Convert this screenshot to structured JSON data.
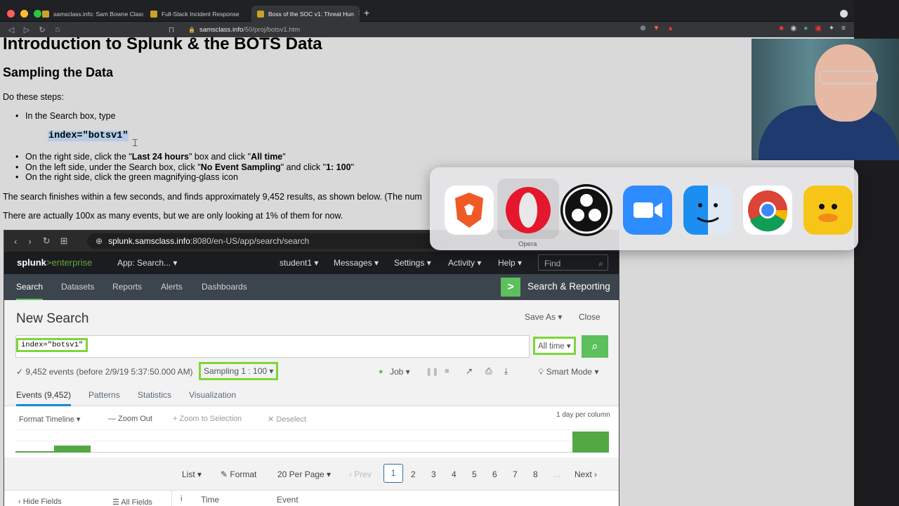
{
  "browser": {
    "tabs": [
      {
        "label": "samsclass.info: Sam Bowne Class In"
      },
      {
        "label": "Full-Stack Incident Response"
      },
      {
        "label": "Boss of the SOC v1: Threat Hun"
      }
    ],
    "url_host": "samsclass.info",
    "url_path": "/50/proj/botsv1.htm"
  },
  "page": {
    "h1": "Introduction to Splunk & the BOTS Data",
    "h2": "Sampling the Data",
    "intro": "Do these steps:",
    "step1": "In the Search box, type",
    "code": "index=\"botsv1\"",
    "step2_a": "On the right side, click the \"",
    "step2_b": "Last 24 hours",
    "step2_c": "\" box and click \"",
    "step2_d": "All time",
    "step2_e": "\"",
    "step3_a": "On the left side, under the Search box, click \"",
    "step3_b": "No Event Sampling",
    "step3_c": "\" and click \"",
    "step3_d": "1: 100",
    "step3_e": "\"",
    "step4": "On the right side, click the green magnifying-glass icon",
    "para1": "The search finishes within a few seconds, and finds approximately 9,452 results, as shown below. (The num",
    "para2": "There are actually 100x as many events, but we are only looking at 1% of them for now."
  },
  "splunk": {
    "url_host": "splunk.samsclass.info",
    "url_rest": ":8080/en-US/app/search/search",
    "logo_a": "splunk",
    "logo_b": ">enterprise",
    "app": "App: Search... ▾",
    "user": "student1 ▾",
    "messages": "Messages ▾",
    "settings": "Settings ▾",
    "activity": "Activity ▾",
    "help": "Help ▾",
    "find": "Find",
    "nav": [
      "Search",
      "Datasets",
      "Reports",
      "Alerts",
      "Dashboards"
    ],
    "app_title": "Search & Reporting",
    "new_search": "New Search",
    "save_as": "Save As ▾",
    "close": "Close",
    "query": "index=\"botsv1\"",
    "time_range": "All time ▾",
    "events_status": "✓ 9,452 events (before 2/9/19 5:37:50.000 AM)",
    "sampling": "Sampling 1 : 100 ▾",
    "job": "Job ▾",
    "mode": "Smart Mode ▾",
    "tabs": [
      "Events (9,452)",
      "Patterns",
      "Statistics",
      "Visualization"
    ],
    "format_timeline": "Format Timeline ▾",
    "zoom_out": "— Zoom Out",
    "zoom_sel": "+ Zoom to Selection",
    "deselect": "✕ Deselect",
    "per_col": "1 day per column",
    "list": "List ▾",
    "format": "✎ Format",
    "per_page": "20 Per Page ▾",
    "prev": "‹ Prev",
    "pages": [
      "1",
      "2",
      "3",
      "4",
      "5",
      "6",
      "7",
      "8",
      "..."
    ],
    "next": "Next ›",
    "hide_fields": "‹ Hide Fields",
    "all_fields": "☰ All Fields",
    "col_i": "i",
    "col_time": "Time",
    "col_event": "Event"
  },
  "dock": {
    "hover_label": "Opera",
    "apps": [
      "brave-icon",
      "opera-icon",
      "obs-icon",
      "zoom-icon",
      "finder-icon",
      "chrome-icon",
      "cyberduck-icon"
    ]
  }
}
